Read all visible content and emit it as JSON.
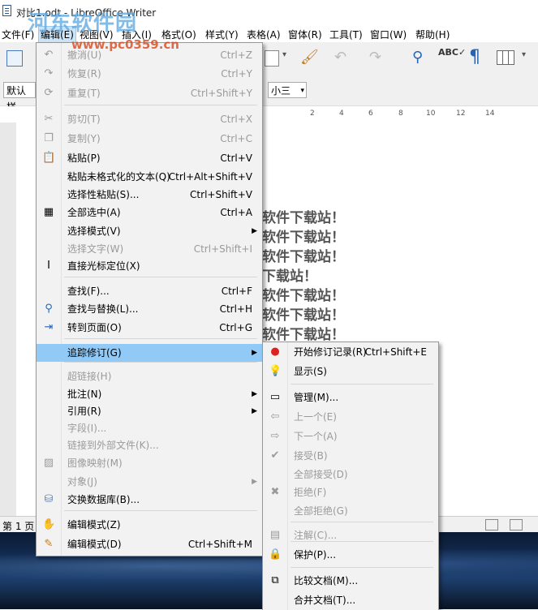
{
  "window": {
    "title": "对比1.odt - LibreOffice Writer"
  },
  "watermark": {
    "main": "河东软件园",
    "url": "www.pc0359.cn"
  },
  "menubar": [
    "文件(F)",
    "编辑(E)",
    "视图(V)",
    "插入(I)",
    "格式(O)",
    "样式(Y)",
    "表格(A)",
    "窗体(R)",
    "工具(T)",
    "窗口(W)",
    "帮助(H)"
  ],
  "toolbar": {
    "paragraph_style": "默认样",
    "font_size": "小三"
  },
  "ruler": [
    "2",
    "4",
    "6",
    "8",
    "10",
    "12",
    "14"
  ],
  "document": {
    "lines": [
      "软件下载站！",
      "软件下载站！",
      "软件下载站！",
      "下载站！",
      "软件下载站！",
      "软件下载站！",
      "软件下载站！"
    ]
  },
  "statusbar": {
    "page": "第 1 页"
  },
  "edit_menu": {
    "items": [
      {
        "label": "撤消(U)",
        "shortcut": "Ctrl+Z",
        "icon": "undo-icon",
        "disabled": true
      },
      {
        "label": "恢复(R)",
        "shortcut": "Ctrl+Y",
        "icon": "redo-icon",
        "disabled": true
      },
      {
        "label": "重复(T)",
        "shortcut": "Ctrl+Shift+Y",
        "icon": "repeat-icon",
        "disabled": true
      },
      {
        "label": "剪切(T)",
        "shortcut": "Ctrl+X",
        "icon": "cut-icon",
        "disabled": true
      },
      {
        "label": "复制(Y)",
        "shortcut": "Ctrl+C",
        "icon": "copy-icon",
        "disabled": true
      },
      {
        "label": "粘贴(P)",
        "shortcut": "Ctrl+V",
        "icon": "paste-icon",
        "disabled": false
      },
      {
        "label": "粘贴未格式化的文本(Q)",
        "shortcut": "Ctrl+Alt+Shift+V",
        "icon": "",
        "disabled": false
      },
      {
        "label": "选择性粘贴(S)...",
        "shortcut": "Ctrl+Shift+V",
        "icon": "",
        "disabled": false
      },
      {
        "label": "全部选中(A)",
        "shortcut": "Ctrl+A",
        "icon": "select-all-icon",
        "disabled": false
      },
      {
        "label": "选择模式(V)",
        "shortcut": "",
        "icon": "",
        "disabled": false,
        "submenu": true
      },
      {
        "label": "选择文字(W)",
        "shortcut": "Ctrl+Shift+I",
        "icon": "",
        "disabled": true
      },
      {
        "label": "直接光标定位(X)",
        "shortcut": "",
        "icon": "text-cursor-icon",
        "disabled": false
      },
      {
        "label": "查找(F)...",
        "shortcut": "Ctrl+F",
        "icon": "",
        "disabled": false
      },
      {
        "label": "查找与替换(L)...",
        "shortcut": "Ctrl+H",
        "icon": "find-replace-icon",
        "disabled": false
      },
      {
        "label": "转到页面(O)",
        "shortcut": "Ctrl+G",
        "icon": "goto-page-icon",
        "disabled": false
      },
      {
        "label": "追踪修订(G)",
        "shortcut": "",
        "icon": "",
        "disabled": false,
        "submenu": true,
        "highlighted": true
      },
      {
        "label": "超链接(H)",
        "shortcut": "",
        "icon": "",
        "disabled": true
      },
      {
        "label": "批注(N)",
        "shortcut": "",
        "icon": "",
        "disabled": false,
        "submenu": true
      },
      {
        "label": "引用(R)",
        "shortcut": "",
        "icon": "",
        "disabled": false,
        "submenu": true
      },
      {
        "label": "字段(I)...",
        "shortcut": "",
        "icon": "",
        "disabled": true
      },
      {
        "label": "链接到外部文件(K)...",
        "shortcut": "",
        "icon": "",
        "disabled": true
      },
      {
        "label": "图像映射(M)",
        "shortcut": "",
        "icon": "image-map-icon",
        "disabled": true
      },
      {
        "label": "对象(J)",
        "shortcut": "",
        "icon": "",
        "disabled": true,
        "submenu": true
      },
      {
        "label": "交换数据库(B)...",
        "shortcut": "",
        "icon": "database-icon",
        "disabled": false
      },
      {
        "label": "编辑模式(Z)",
        "shortcut": "",
        "icon": "hand-icon",
        "disabled": false
      },
      {
        "label": "编辑模式(D)",
        "shortcut": "Ctrl+Shift+M",
        "icon": "edit-mode-icon",
        "disabled": false
      }
    ]
  },
  "track_changes_menu": {
    "items": [
      {
        "label": "开始修订记录(R)",
        "shortcut": "Ctrl+Shift+E",
        "icon": "record-icon",
        "disabled": false
      },
      {
        "label": "显示(S)",
        "shortcut": "",
        "icon": "lightbulb-icon",
        "disabled": false
      },
      {
        "label": "管理(M)...",
        "shortcut": "",
        "icon": "manage-icon",
        "disabled": false
      },
      {
        "label": "上一个(E)",
        "shortcut": "",
        "icon": "arrow-left-icon",
        "disabled": true
      },
      {
        "label": "下一个(A)",
        "shortcut": "",
        "icon": "arrow-right-icon",
        "disabled": true
      },
      {
        "label": "接受(B)",
        "shortcut": "",
        "icon": "check-icon",
        "disabled": true
      },
      {
        "label": "全部接受(D)",
        "shortcut": "",
        "icon": "",
        "disabled": true
      },
      {
        "label": "拒绝(F)",
        "shortcut": "",
        "icon": "x-icon",
        "disabled": true
      },
      {
        "label": "全部拒绝(G)",
        "shortcut": "",
        "icon": "",
        "disabled": true
      },
      {
        "label": "注解(C)...",
        "shortcut": "",
        "icon": "comment-icon",
        "disabled": true
      },
      {
        "label": "保护(P)...",
        "shortcut": "",
        "icon": "lock-icon",
        "disabled": false
      },
      {
        "label": "比较文档(M)...",
        "shortcut": "",
        "icon": "compare-icon",
        "disabled": false
      },
      {
        "label": "合并文档(T)...",
        "shortcut": "",
        "icon": "",
        "disabled": false
      }
    ]
  }
}
